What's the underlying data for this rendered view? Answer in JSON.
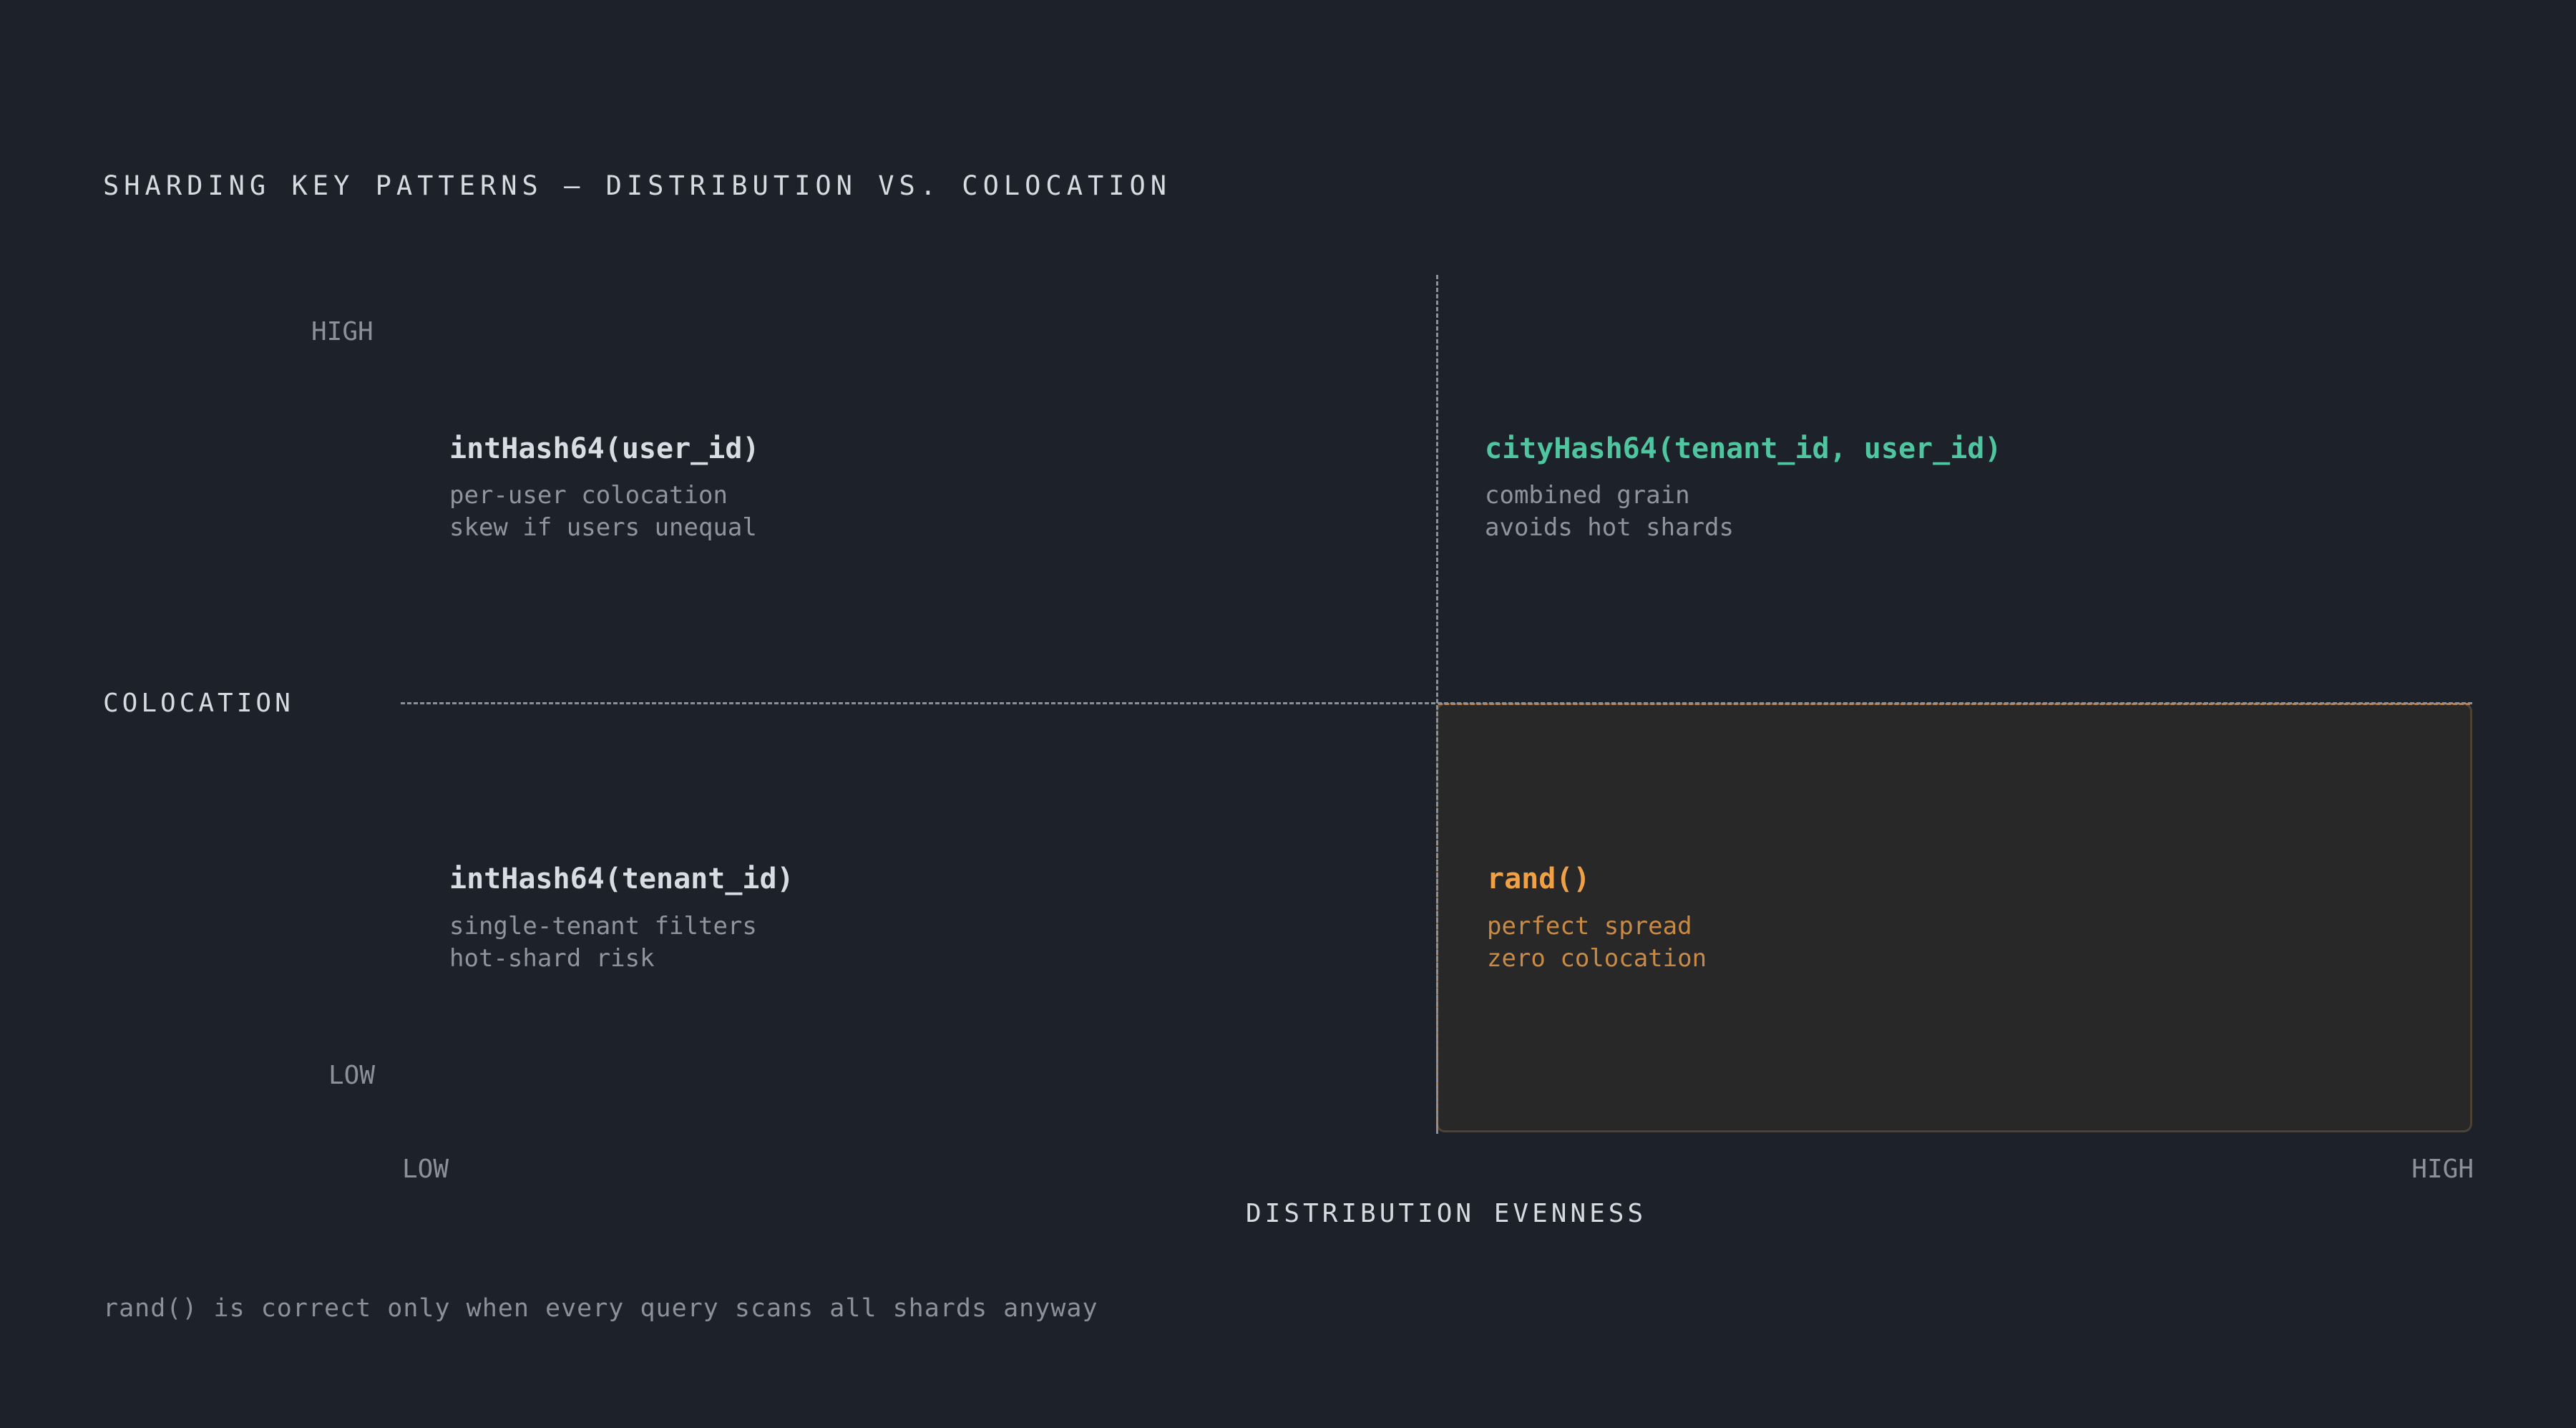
{
  "title": "SHARDING KEY PATTERNS — DISTRIBUTION VS. COLOCATION",
  "y_axis": {
    "label": "COLOCATION",
    "high": "HIGH",
    "low": "LOW"
  },
  "x_axis": {
    "label": "DISTRIBUTION EVENNESS",
    "low": "LOW",
    "high": "HIGH"
  },
  "quadrants": {
    "top_left": {
      "key": "intHash64(user_id)",
      "notes": [
        "per-user colocation",
        "skew if users unequal"
      ]
    },
    "top_right": {
      "key": "cityHash64(tenant_id, user_id)",
      "notes": [
        "combined grain",
        "avoids hot shards"
      ]
    },
    "bottom_left": {
      "key": "intHash64(tenant_id)",
      "notes": [
        "single-tenant filters",
        "hot-shard risk"
      ]
    },
    "bottom_right": {
      "key": "rand()",
      "notes": [
        "perfect spread",
        "zero colocation"
      ]
    }
  },
  "footnote": "rand() is correct only when every query scans all shards anyway",
  "colors": {
    "background": "#1d2129",
    "recommended": "#4fc6a0",
    "warning": "#f0a045",
    "warning_fill": "#282828"
  }
}
